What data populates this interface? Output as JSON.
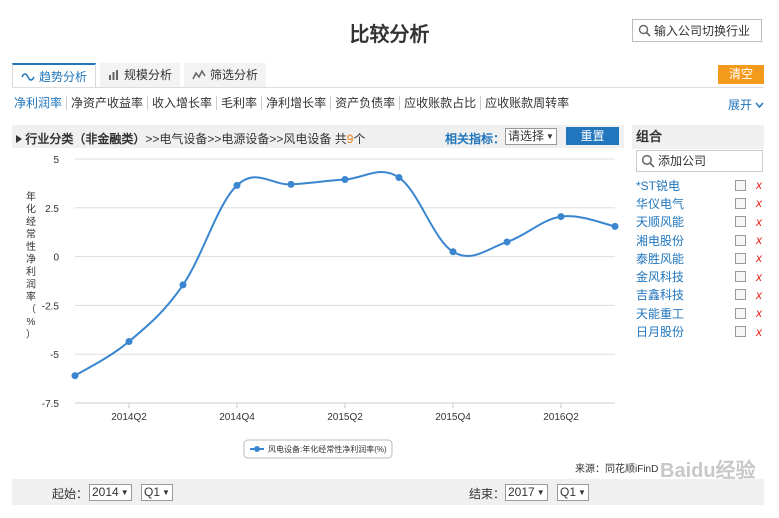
{
  "page": {
    "title": "比较分析"
  },
  "search": {
    "placeholder": "输入公司切换行业"
  },
  "tabs": [
    {
      "label": "趋势分析",
      "icon": "trend-icon"
    },
    {
      "label": "规模分析",
      "icon": "bar-chart-icon"
    },
    {
      "label": "筛选分析",
      "icon": "filter-chart-icon"
    }
  ],
  "clear_label": "清空",
  "metrics": [
    "净利润率",
    "净资产收益率",
    "收入增长率",
    "毛利率",
    "净利增长率",
    "资产负债率",
    "应收账款占比",
    "应收账款周转率"
  ],
  "expand_label": "展开",
  "industry": {
    "prefix": "行业分类（非金融类）",
    "path": ">>电气设备>>电源设备>>风电设备",
    "count_prefix": "共",
    "count": "9",
    "count_suffix": "个"
  },
  "related": {
    "label": "相关指标：",
    "select": "请选择"
  },
  "reset_label": "重置",
  "group": {
    "title": "组合",
    "add_placeholder": "添加公司",
    "companies": [
      "*ST锐电",
      "华仪电气",
      "天顺风能",
      "湘电股份",
      "泰胜风能",
      "金风科技",
      "吉鑫科技",
      "天能重工",
      "日月股份"
    ],
    "remove_mark": "x"
  },
  "chart_data": {
    "type": "line",
    "ylabel": "年化经常性净利润率（%）",
    "ylim": [
      -7.5,
      5
    ],
    "yticks": [
      "5",
      "2.5",
      "0",
      "-2.5",
      "-5",
      "-7.5"
    ],
    "ytick_values": [
      5,
      2.5,
      0,
      -2.5,
      -5,
      -7.5
    ],
    "x": [
      "2014Q1",
      "2014Q2",
      "2014Q3",
      "2014Q4",
      "2015Q1",
      "2015Q2",
      "2015Q3",
      "2015Q4",
      "2016Q1",
      "2016Q2",
      "2016Q3"
    ],
    "xtick_labels": [
      "2014Q2",
      "2014Q4",
      "2015Q2",
      "2015Q4",
      "2016Q2"
    ],
    "series": [
      {
        "name": "风电设备:年化经常性净利润率(%)",
        "color": "#3a86d0",
        "values": [
          -6.1,
          -4.35,
          -1.45,
          3.65,
          3.7,
          3.95,
          4.05,
          0.25,
          0.75,
          2.05,
          1.55
        ]
      }
    ],
    "grid": true,
    "legend": "bottom"
  },
  "source_label": "来源：同花顺iFinD",
  "range": {
    "start_label": "起始：",
    "start_year": "2014",
    "start_q": "Q1",
    "end_label": "结束：",
    "end_year": "2017",
    "end_q": "Q1"
  },
  "watermark": "Baidu经验"
}
